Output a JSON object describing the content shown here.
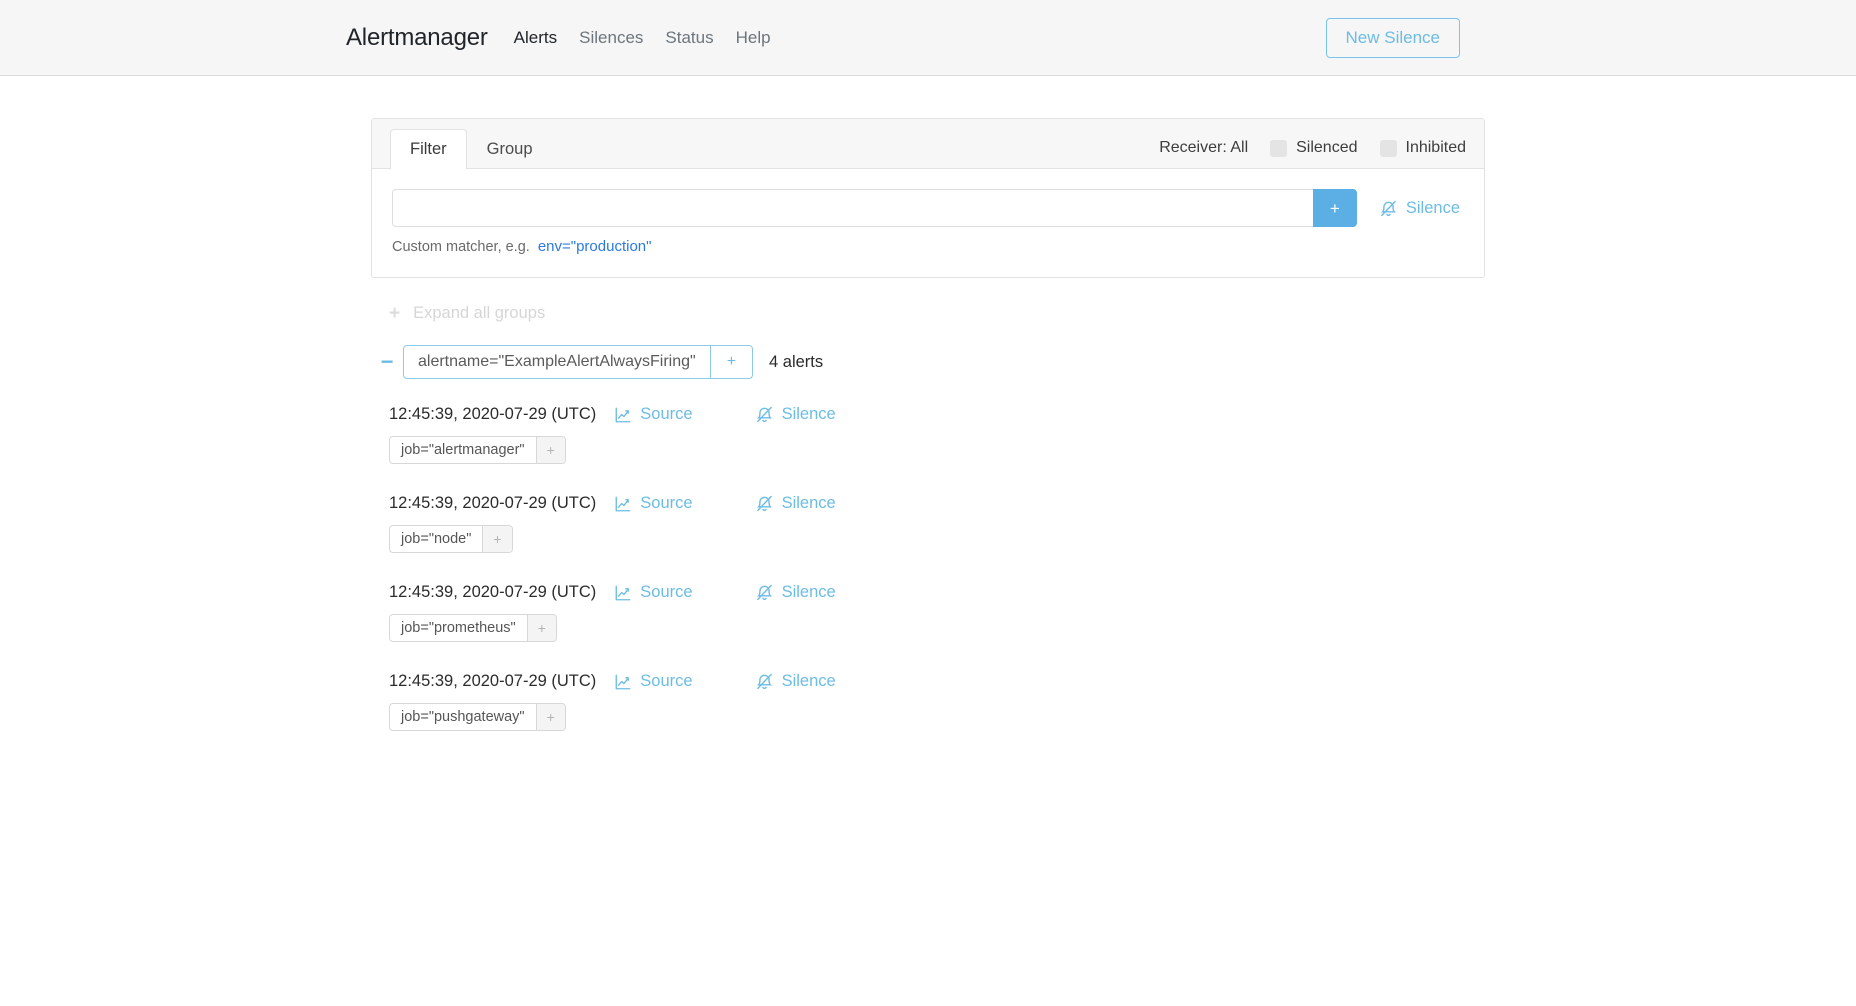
{
  "navbar": {
    "brand": "Alertmanager",
    "links": [
      {
        "label": "Alerts",
        "active": true
      },
      {
        "label": "Silences",
        "active": false
      },
      {
        "label": "Status",
        "active": false
      },
      {
        "label": "Help",
        "active": false
      }
    ],
    "new_silence_button": "New Silence"
  },
  "filter_card": {
    "tabs": [
      {
        "label": "Filter",
        "active": true
      },
      {
        "label": "Group",
        "active": false
      }
    ],
    "receiver_label": "Receiver: All",
    "checkboxes": [
      {
        "label": "Silenced",
        "checked": false
      },
      {
        "label": "Inhibited",
        "checked": false
      }
    ],
    "matcher_input": {
      "value": "",
      "placeholder": ""
    },
    "add_button": "+",
    "silence_link": "Silence",
    "hint_prefix": "Custom matcher, e.g.",
    "hint_example": "env=\"production\""
  },
  "expand_all": {
    "icon": "plus-icon",
    "label": "Expand all groups"
  },
  "group": {
    "toggle_icon": "minus-icon",
    "matcher": "alertname=\"ExampleAlertAlwaysFiring\"",
    "matcher_add": "+",
    "count_label": "4 alerts"
  },
  "alerts": [
    {
      "time": "12:45:39, 2020-07-29 (UTC)",
      "source_label": "Source",
      "silence_label": "Silence",
      "label_text": "job=\"alertmanager\"",
      "label_add": "+"
    },
    {
      "time": "12:45:39, 2020-07-29 (UTC)",
      "source_label": "Source",
      "silence_label": "Silence",
      "label_text": "job=\"node\"",
      "label_add": "+"
    },
    {
      "time": "12:45:39, 2020-07-29 (UTC)",
      "source_label": "Source",
      "silence_label": "Silence",
      "label_text": "job=\"prometheus\"",
      "label_add": "+"
    },
    {
      "time": "12:45:39, 2020-07-29 (UTC)",
      "source_label": "Source",
      "silence_label": "Silence",
      "label_text": "job=\"pushgateway\"",
      "label_add": "+"
    }
  ],
  "colors": {
    "accent": "#6cbce4",
    "accent_solid": "#5bafe5",
    "link": "#2a7ae2",
    "navbar_bg": "#f6f6f6",
    "muted": "#6c757d"
  }
}
